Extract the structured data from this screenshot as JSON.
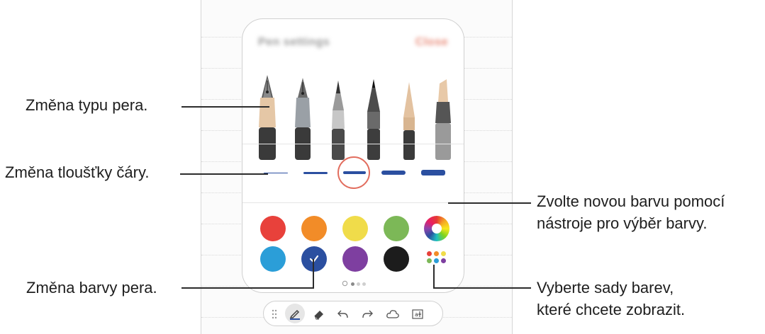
{
  "callouts": {
    "pen_type": "Změna typu pera.",
    "line_thickness": "Změna tloušťky čáry.",
    "pen_color": "Změna barvy pera.",
    "new_color_line1": "Zvolte novou barvu pomocí",
    "new_color_line2": "nástroje pro výběr barvy.",
    "color_sets_line1": "Vyberte sady barev,",
    "color_sets_line2": "které chcete zobrazit."
  },
  "panel": {
    "title": "Pen settings",
    "close": "Close"
  },
  "pens": [
    "fountain-pen",
    "calligraphy-pen",
    "pen",
    "pencil",
    "marker",
    "highlighter"
  ],
  "thickness_levels": [
    1,
    2,
    3,
    4,
    5
  ],
  "selected_thickness": 3,
  "colors": {
    "palette": [
      "#e8413b",
      "#f28c28",
      "#f0dc4a",
      "#7cb857",
      "#2b9ed8",
      "#2b4fa0",
      "#7e3fa0",
      "#1c1c1c"
    ],
    "selected": "#2b4fa0",
    "callout_accent": "#e26d5e"
  },
  "pager": {
    "pages": 3,
    "current": 1
  },
  "toolbar": [
    "drag-handle",
    "pen-tool",
    "eraser",
    "undo",
    "redo",
    "shapes",
    "text-mode"
  ]
}
